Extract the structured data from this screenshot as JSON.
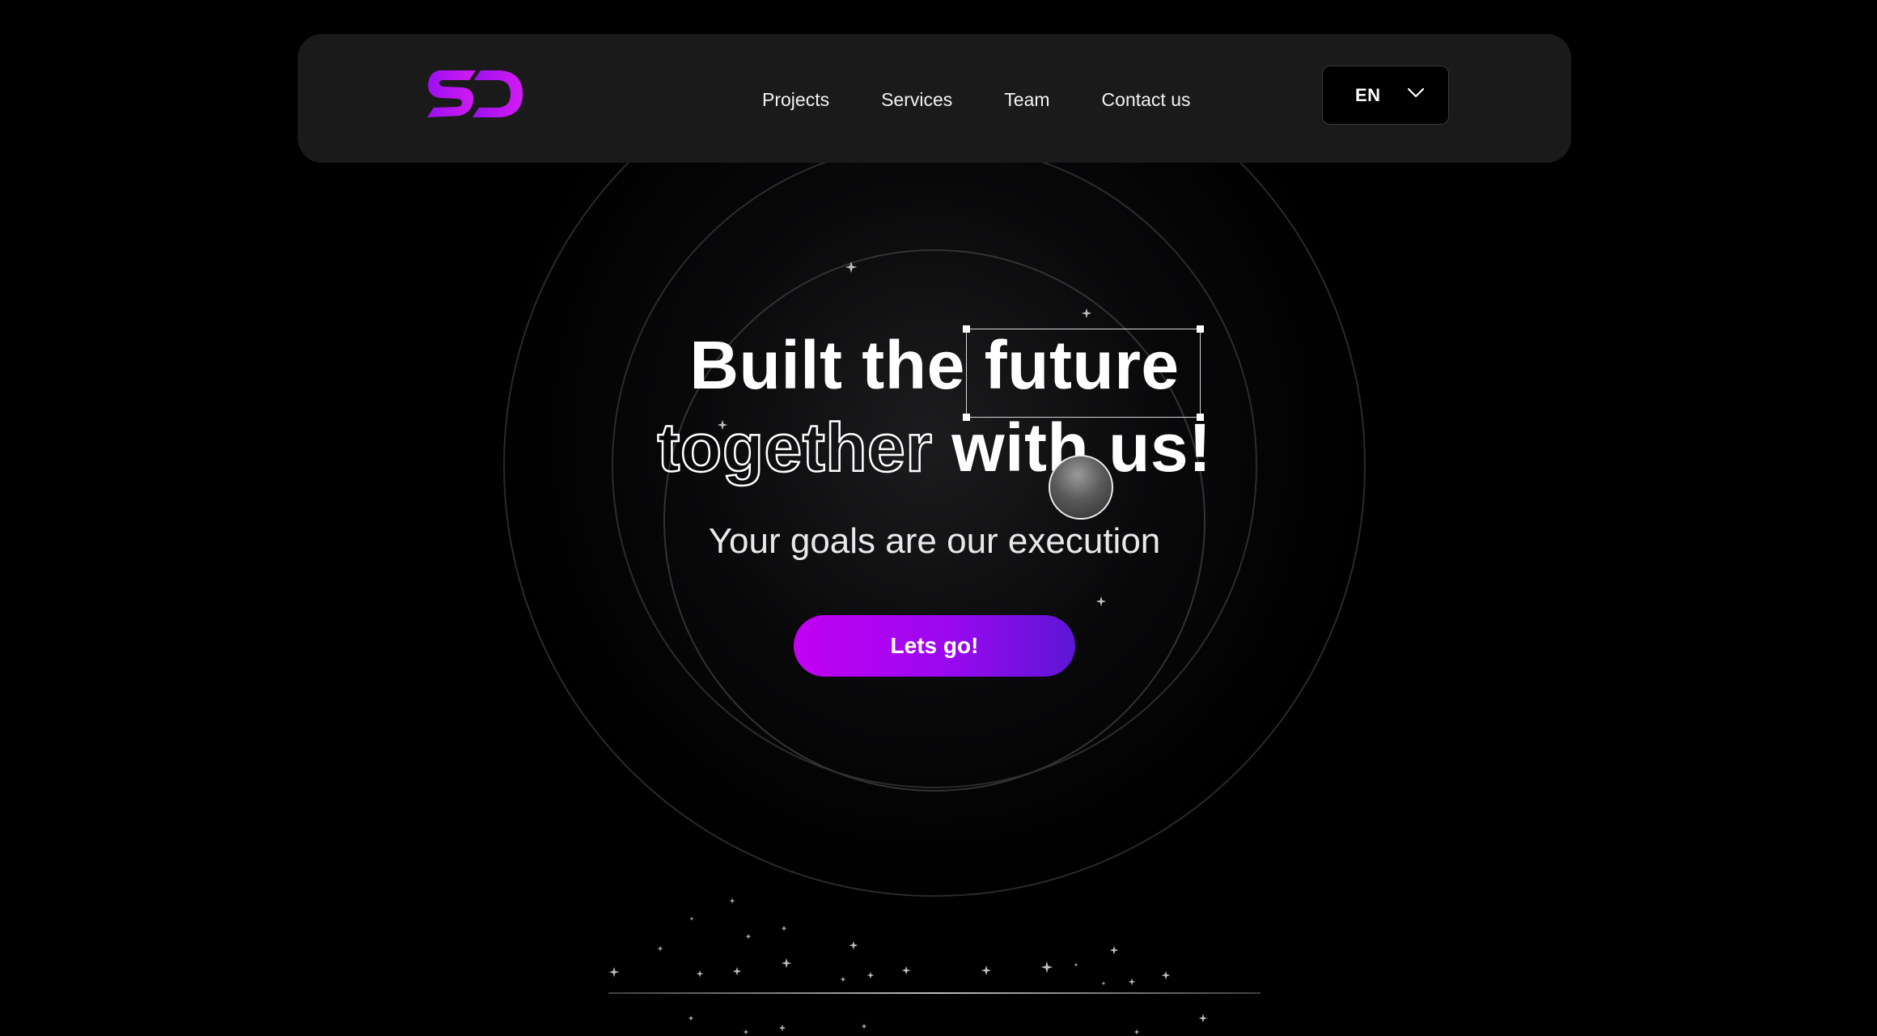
{
  "navbar": {
    "logo_text": "SD",
    "links": [
      "Projects",
      "Services",
      "Team",
      "Contact us"
    ],
    "language": {
      "selected": "EN"
    }
  },
  "hero": {
    "headline_part1": "Built the",
    "headline_highlight": "future",
    "headline_outline": "together",
    "headline_part2": "with us!",
    "subtitle": "Your goals are our execution",
    "cta_label": "Lets go!"
  },
  "colors": {
    "background": "#000000",
    "navbar_bg": "#1a1a1a",
    "accent_start": "#c200f2",
    "accent_end": "#5d16d4",
    "text": "#ffffff"
  },
  "icons": {
    "logo": "sd-logo",
    "language_dropdown": "chevron-down-icon",
    "cursor": "cursor-ball",
    "decoration": "sparkle-icon"
  }
}
